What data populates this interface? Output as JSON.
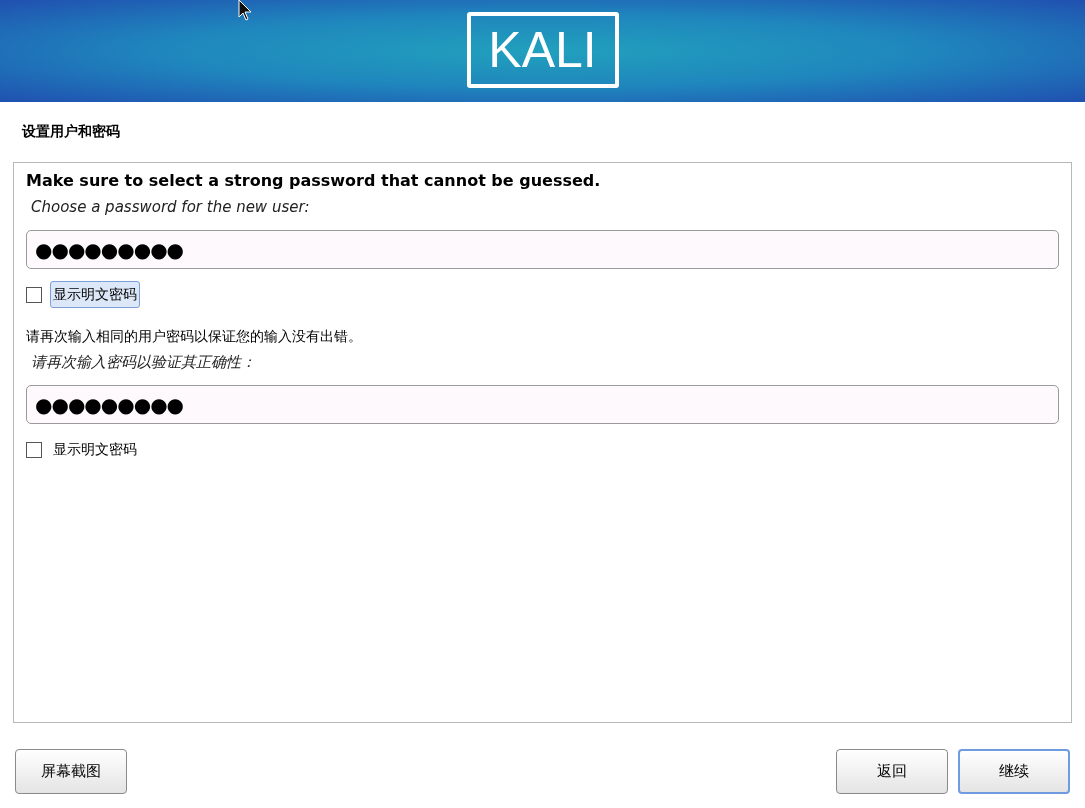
{
  "banner": {
    "logo": "KALI"
  },
  "page_title": "设置用户和密码",
  "sections": [
    {
      "heading": "Make sure to select a strong password that cannot be guessed.",
      "prompt": "Choose a password for the new user:",
      "value": "●●●●●●●●●",
      "show_password": {
        "label": "显示明文密码",
        "checked": false,
        "focused": true
      }
    },
    {
      "heading": "请再次输入相同的用户密码以保证您的输入没有出错。",
      "prompt": "请再次输入密码以验证其正确性：",
      "value": "●●●●●●●●●",
      "show_password": {
        "label": "显示明文密码",
        "checked": false,
        "focused": false
      }
    }
  ],
  "buttons": [
    {
      "label": "屏幕截图",
      "focused": false
    },
    {
      "label": "返回",
      "focused": false
    },
    {
      "label": "继续",
      "focused": true
    }
  ]
}
